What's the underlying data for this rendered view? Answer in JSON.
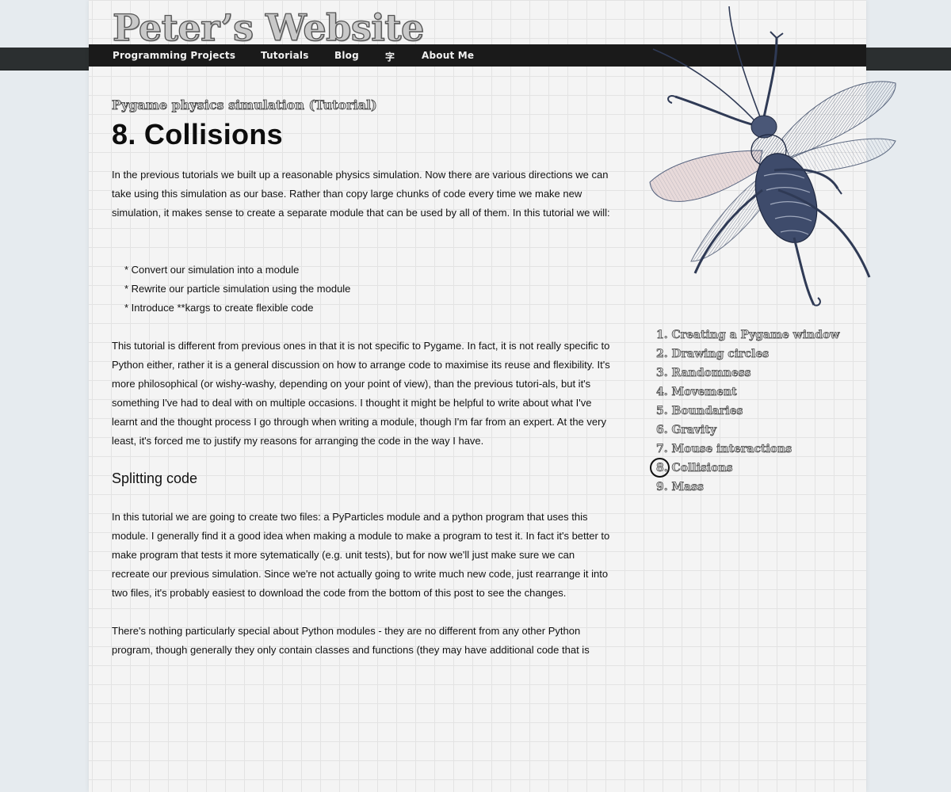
{
  "site": {
    "title": "Peter’s Website"
  },
  "nav": {
    "items": [
      {
        "label": "Programming Projects"
      },
      {
        "label": "Tutorials"
      },
      {
        "label": "Blog"
      },
      {
        "label": "字"
      },
      {
        "label": "About Me"
      }
    ]
  },
  "article": {
    "series_title": "Pygame physics simulation (Tutorial)",
    "title": "8. Collisions",
    "intro": "In the previous tutorials we built up a reasonable physics simulation. Now there are various directions we can take using this simulation as our base. Rather than copy large chunks of code every time we make new simulation, it makes sense to create a separate module that can be used by all of them. In this tutorial we will:",
    "bullets": [
      "* Convert our simulation into a module",
      "* Rewrite our particle simulation using the module",
      "* Introduce **kargs to create flexible code"
    ],
    "paragraph2": "This tutorial is different from previous ones in that it is not specific to Pygame. In fact, it is not really specific to Python either, rather it is a general discussion on how to arrange code to maximise its reuse and flexibility. It's more philosophical (or wishy-washy, depending on your point of view), than the previous tutori-als, but it's something I've had to deal with on multiple occasions. I thought it might be helpful to write about what I've learnt and the thought process I go through when writing a module, though I'm far from an expert. At the very least, it's forced me to justify my reasons for arranging the code in the way I have.",
    "heading": "Splitting code",
    "paragraph3": "In this tutorial we are going to create two files: a PyParticles module and a python program that uses this module. I generally find it a good idea when making a module to make a program to test it. In fact it's better to make program that tests it more sytematically (e.g. unit tests), but for now we'll just make sure we can recreate our previous simulation. Since we're not actually going to write much new code, just rearrange it into two files, it's probably easiest to download the code from the bottom of this post to see the changes.",
    "paragraph4": "There's nothing particularly special about Python modules - they are no different from any other Python program, though generally they only contain classes and functions (they may have additional code that is"
  },
  "toc": {
    "items": [
      {
        "label": "1. Creating a Pygame window"
      },
      {
        "label": "2. Drawing circles"
      },
      {
        "label": "3. Randomness"
      },
      {
        "label": "4. Movement"
      },
      {
        "label": "5. Boundaries"
      },
      {
        "label": "6. Gravity"
      },
      {
        "label": "7. Mouse interactions"
      },
      {
        "label": "8. Collisions"
      },
      {
        "label": "9. Mass"
      }
    ],
    "current_index": 7
  }
}
